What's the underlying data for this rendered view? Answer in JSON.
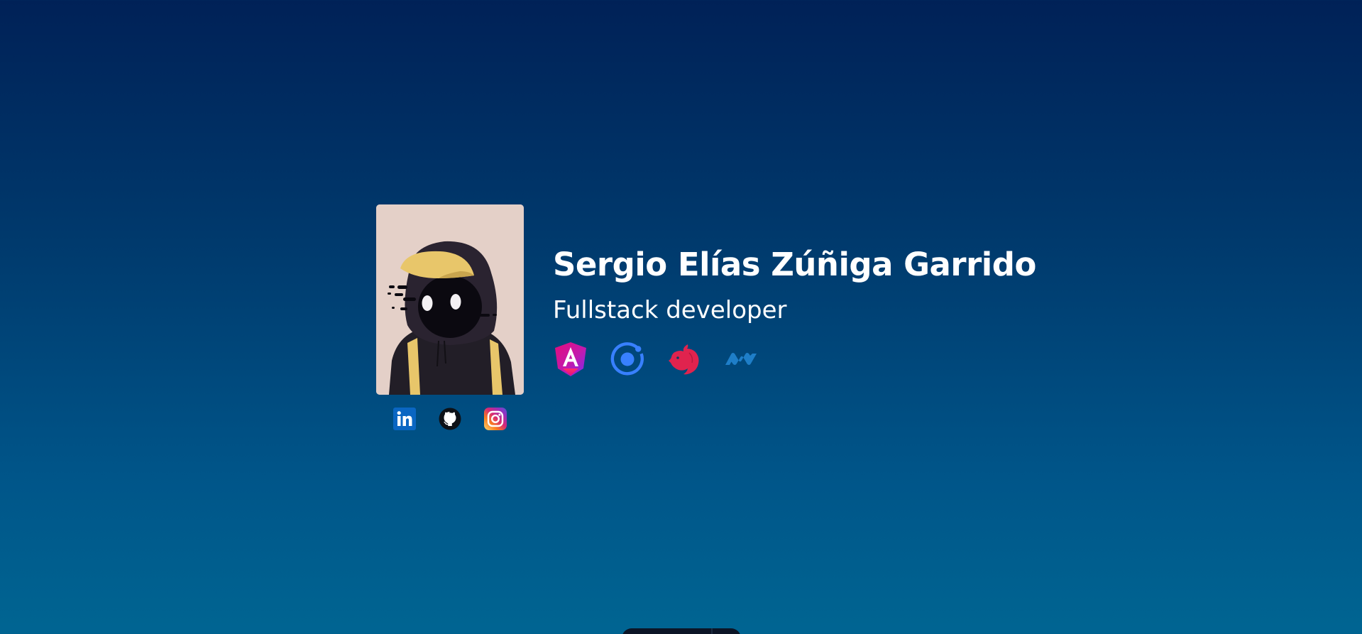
{
  "profile": {
    "name": "Sergio Elías Zúñiga Garrido",
    "role": "Fullstack developer",
    "avatar": {
      "icon": "hooded-character-avatar",
      "background_color": "#e4d0c8",
      "cap_color": "#e8c66a",
      "hoodie_color": "#221e27"
    }
  },
  "social": [
    {
      "icon": "linkedin-icon",
      "color": "#0a66c2"
    },
    {
      "icon": "github-icon",
      "color": "#0d1117"
    },
    {
      "icon": "instagram-icon",
      "color": "#dd2a7b"
    }
  ],
  "tech_stack": [
    {
      "icon": "angular-icon",
      "color": "#e40c7a"
    },
    {
      "icon": "ionic-icon",
      "color": "#3880ff"
    },
    {
      "icon": "nestjs-icon",
      "color": "#e0234e"
    },
    {
      "icon": "dotnet-icon",
      "color": "#1e7ec8"
    }
  ],
  "theme": {
    "background_top": "#002157",
    "background_bottom": "#006592",
    "text_color": "#ffffff"
  }
}
